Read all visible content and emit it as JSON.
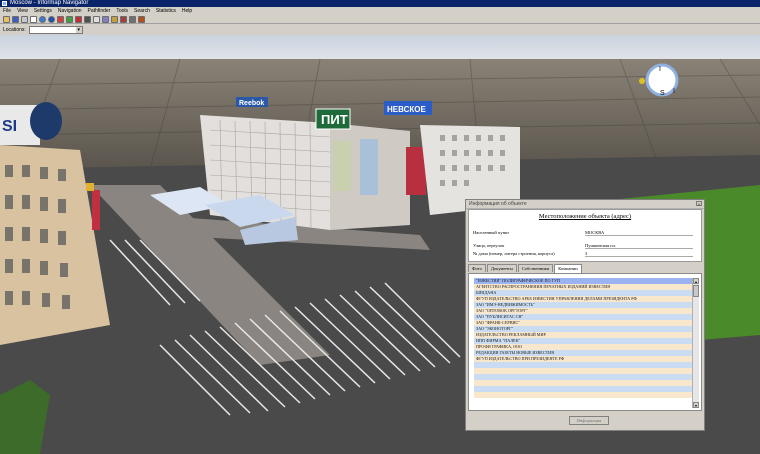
{
  "window": {
    "title": "Moscow - Informap Navigator"
  },
  "menu": [
    "File",
    "View",
    "Settings",
    "Navigation",
    "Pathfinder",
    "Tools",
    "Search",
    "Statistics",
    "Help"
  ],
  "toolbar": {
    "icons": [
      "open-icon",
      "save-icon",
      "print-icon",
      "pointer-icon",
      "globe-icon",
      "info-icon",
      "zoom-in-icon",
      "zoom-out-icon",
      "flag-icon",
      "camera-icon",
      "list-icon",
      "grid-icon",
      "chart-icon",
      "bookmark-icon",
      "settings-icon",
      "tool-icon"
    ]
  },
  "location": {
    "label": "Locations:",
    "value": ""
  },
  "scene": {
    "signs": {
      "left": "SI",
      "center": "ПИТ",
      "right": "НЕВСКОЕ",
      "logo": "Reebok"
    },
    "compass": {
      "n": "I",
      "s": "S",
      "e": "I"
    }
  },
  "dialog": {
    "title": "Информация об объекте",
    "heading": "Местоположение объекта (адрес)",
    "fields": [
      {
        "label": "Населенный пункт",
        "value": "МОСКВА"
      },
      {
        "label": "Улица, переулок",
        "value": "Пушкинская пл."
      },
      {
        "label": "№ дома (номер, литера строения, корпуса)",
        "value": "3"
      }
    ],
    "tabs": [
      "Фото",
      "Документы",
      "Собственники",
      "Компании"
    ],
    "active_tab": 3,
    "companies": [
      "\"ИЗВЕСТИЯ\" ПОЛИГРАФИЧЕСКОЕ ПО ГУП",
      "АГЕНТСТВО РАСПРОСТРАНЕНИЯ ПЕЧАТНЫХ ИЗДАНИЙ ИЗВЕСТИЯ",
      "БИНДАНА",
      "ФГУП ИЗДАТЕЛЬСТВО АРБЕ ИЗВЕСТИЯ УПРАВЛЕНИЯ ДЕЛАМИ ПРЕЗИДЕНТА РФ",
      "ЗАО \"ИМЭ-НЕДВИЖИМОСТЬ\"",
      "ЗАО \"ОПТОВОК ОРГТОРГ\"",
      "ЗАО \"ПУБЛИСИТАС СН\"",
      "ЗАО \"ФРАНК-СЕРВИС\"",
      "ЗАО \"ЭКОНОТОРГ\"",
      "ИЗДАТЕЛЬСТВО РЕКЛАМНЫЙ МИР",
      "НПП ФИРМА \"ПАЛЕК\"",
      "ПРОФИ ГРАФИКА, ООО",
      "РЕДАКЦИЯ ГАЗЕТЫ НОВЫЕ ИЗВЕСТИЯ",
      "ФГУП ИЗДАТЕЛЬСТВО ПРИ ПРЕЗИДЕНТЕ РФ",
      "",
      "",
      "",
      "",
      "",
      ""
    ],
    "ok_label": "Информация"
  }
}
